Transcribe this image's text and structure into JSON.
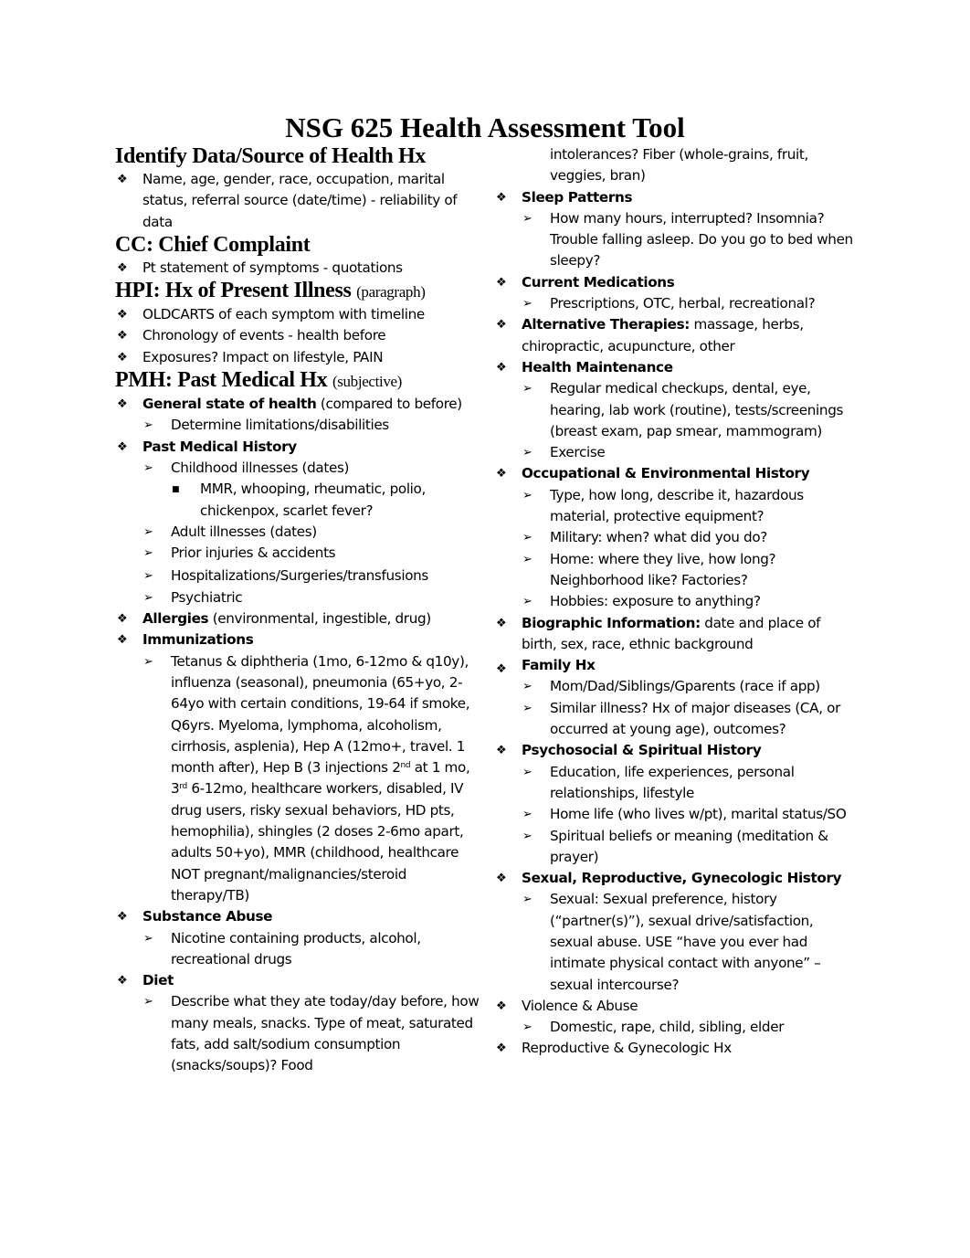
{
  "document": {
    "title": "NSG 625 Health Assessment Tool",
    "bullet_glyphs": {
      "level1": "four-diamond-icon",
      "level2": "arrowhead-icon",
      "level3": "square-icon"
    },
    "left_column": {
      "identify": {
        "heading": "Identify Data/Source of Health Hx",
        "items": [
          "Name, age, gender, race, occupation, marital status, referral source (date/time) - reliability of data"
        ]
      },
      "cc": {
        "heading": "CC: Chief Complaint",
        "items": [
          "Pt statement of symptoms - quotations"
        ]
      },
      "hpi": {
        "heading": "HPI: Hx of Present Illness",
        "heading_note": "(paragraph)",
        "items": [
          "OLDCARTS of each symptom with timeline",
          "Chronology of events - health before",
          "Exposures? Impact on lifestyle, PAIN"
        ]
      },
      "pmh": {
        "heading": "PMH: Past Medical Hx",
        "heading_note": "(subjective)",
        "general": {
          "label": "General state of health",
          "note": " (compared to before)",
          "sub": [
            "Determine limitations/disabilities"
          ]
        },
        "past_medical": {
          "label": "Past Medical History",
          "childhood": "Childhood illnesses (dates)",
          "childhood_sub": "MMR, whooping, rheumatic, polio, chickenpox, scarlet fever?",
          "sub": [
            "Adult illnesses (dates)",
            "Prior injuries & accidents",
            "Hospitalizations/Surgeries/transfusions",
            "Psychiatric"
          ]
        },
        "allergies": {
          "label": "Allergies",
          "note": " (environmental, ingestible, drug)"
        },
        "immunizations": {
          "label": "Immunizations",
          "text_a": "Tetanus & diphtheria (1mo, 6-12mo & q10y), influenza (seasonal), pneumonia (65+yo, 2-64yo with certain conditions, 19-64 if smoke, Q6yrs. Myeloma, lymphoma, alcoholism, cirrhosis, asplenia), Hep A (12mo+, travel. 1 month after), Hep B (3 injections 2",
          "sup_a": "nd",
          "text_b": " at 1 mo, 3",
          "sup_b": "rd",
          "text_c": " 6-12mo, healthcare workers, disabled, IV drug users, risky sexual behaviors, HD pts, hemophilia), shingles (2 doses 2-6mo apart, adults 50+yo), MMR (childhood, healthcare NOT pregnant/malignancies/steroid therapy/TB)"
        },
        "substance": {
          "label": "Substance Abuse",
          "sub": [
            "Nicotine containing products, alcohol, recreational drugs"
          ]
        },
        "diet": {
          "label": "Diet",
          "sub_left": "Describe what they ate today/day before, how many meals, snacks. Type of meat, saturated fats, add salt/sodium consumption (snacks/soups)? Food",
          "sub_right_cont": "intolerances? Fiber (whole-grains, fruit, veggies, bran)"
        }
      }
    },
    "right_column": {
      "sleep": {
        "label": "Sleep Patterns",
        "sub": [
          "How many hours, interrupted? Insomnia? Trouble falling asleep. Do you go to bed when sleepy?"
        ]
      },
      "meds": {
        "label": "Current Medications",
        "sub": [
          "Prescriptions, OTC, herbal, recreational?"
        ]
      },
      "alt": {
        "label": "Alternative Therapies:",
        "line1": " massage, herbs,",
        "line2": "chiropractic, acupuncture, other"
      },
      "maintenance": {
        "label": "Health Maintenance",
        "sub": [
          "Regular medical checkups, dental, eye, hearing, lab work (routine), tests/screenings (breast exam, pap smear, mammogram)",
          "Exercise"
        ]
      },
      "occupational": {
        "label": "Occupational & Environmental History",
        "sub": [
          "Type, how long, describe it, hazardous material, protective equipment?",
          "Military: when? what did you do?",
          "Home: where they live, how long? Neighborhood like? Factories?",
          "Hobbies: exposure to anything?"
        ]
      },
      "biographic": {
        "label": "Biographic Information:",
        "line1": " date and place of",
        "line2": "birth, sex, race, ethnic background"
      },
      "family": {
        "label": "Family Hx",
        "sub": [
          "Mom/Dad/Siblings/Gparents (race if app)",
          "Similar illness? Hx of major diseases (CA, or occurred at young age), outcomes?"
        ]
      },
      "psychosocial": {
        "label": "Psychosocial & Spiritual History",
        "sub": [
          "Education, life experiences, personal relationships, lifestyle",
          "Home life (who lives w/pt), marital status/SO",
          "Spiritual beliefs or meaning (meditation & prayer)"
        ]
      },
      "sexual": {
        "label": "Sexual, Reproductive, Gynecologic History",
        "sub": [
          "Sexual: Sexual preference, history (“partner(s)”), sexual drive/satisfaction, sexual abuse. USE “have you ever had intimate physical contact with anyone” – sexual intercourse?"
        ]
      },
      "violence": {
        "label": "Violence & Abuse",
        "sub": [
          "Domestic, rape, child, sibling, elder"
        ]
      },
      "reproductive": {
        "label": "Reproductive & Gynecologic Hx"
      }
    }
  }
}
